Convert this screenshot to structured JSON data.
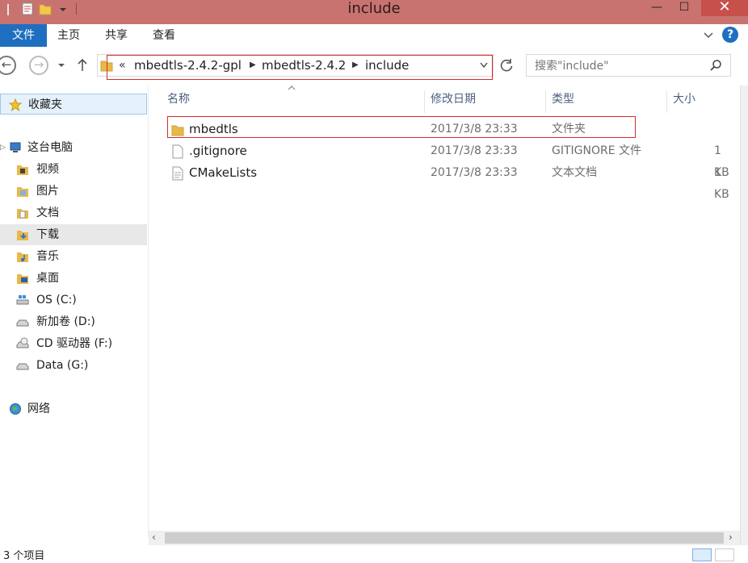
{
  "window": {
    "title": "include",
    "controls": [
      "minimize",
      "maximize",
      "close"
    ]
  },
  "ribbon": {
    "tabs": [
      "文件",
      "主页",
      "共享",
      "查看"
    ],
    "help": "?"
  },
  "nav": {
    "back_icon": "arrow-left-icon",
    "forward_icon": "arrow-right-icon",
    "up_icon": "arrow-up-icon",
    "breadcrumb_overflow": "«",
    "breadcrumb": [
      "mbedtls-2.4.2-gpl",
      "mbedtls-2.4.2",
      "include"
    ],
    "search_placeholder": "搜索\"include\""
  },
  "sidebar": {
    "favorites": "收藏夹",
    "this_pc": "这台电脑",
    "items": [
      "视频",
      "图片",
      "文档",
      "下载",
      "音乐",
      "桌面",
      "OS (C:)",
      "新加卷 (D:)",
      "CD 驱动器 (F:)",
      "Data (G:)"
    ],
    "network": "网络"
  },
  "columns": [
    "名称",
    "修改日期",
    "类型",
    "大小"
  ],
  "files": [
    {
      "name": "mbedtls",
      "date": "2017/3/8 23:33",
      "type": "文件夹",
      "size": "",
      "icon": "folder-icon"
    },
    {
      "name": ".gitignore",
      "date": "2017/3/8 23:33",
      "type": "GITIGNORE 文件",
      "size": "1 KB",
      "icon": "file-icon"
    },
    {
      "name": "CMakeLists",
      "date": "2017/3/8 23:33",
      "type": "文本文档",
      "size": "1 KB",
      "icon": "text-file-icon"
    }
  ],
  "status": {
    "text": "3 个项目"
  },
  "colors": {
    "titlebar": "#c8736f",
    "file_tab": "#1e6fc0",
    "highlight_box": "#d42a2a",
    "selection": "#e5f1fb"
  }
}
